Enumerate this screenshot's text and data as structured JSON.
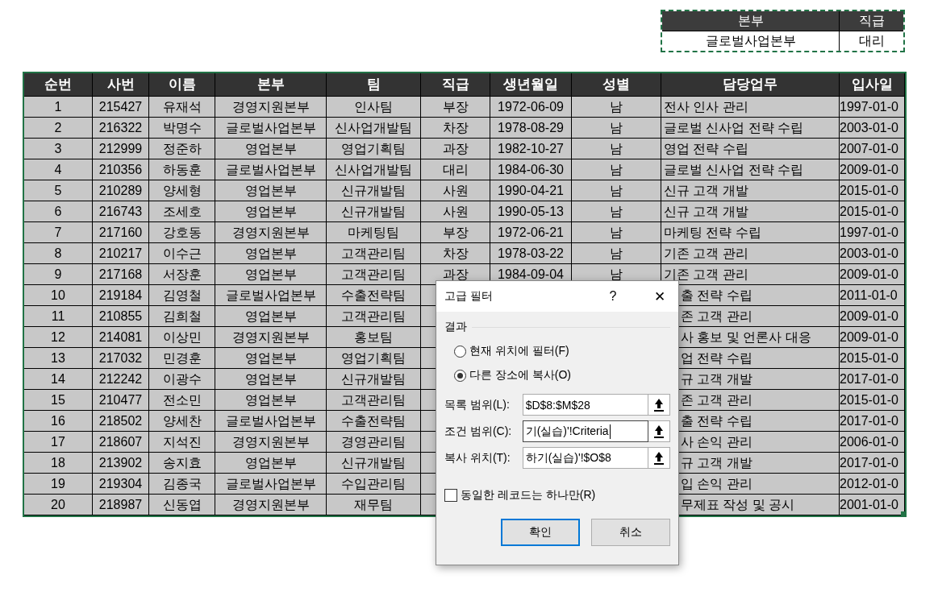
{
  "criteria": {
    "columns": [
      "본부",
      "직급"
    ],
    "values": [
      "글로벌사업본부",
      "대리"
    ]
  },
  "table": {
    "columns": [
      "순번",
      "사번",
      "이름",
      "본부",
      "팀",
      "직급",
      "생년월일",
      "성별",
      "담당업무",
      "입사일"
    ],
    "rows": [
      {
        "no": "1",
        "id": "215427",
        "name": "유재석",
        "division": "경영지원본부",
        "team": "인사팀",
        "rank": "부장",
        "birth": "1972-06-09",
        "gender": "남",
        "duty": "전사 인사 관리",
        "hire": "1997-01-0"
      },
      {
        "no": "2",
        "id": "216322",
        "name": "박명수",
        "division": "글로벌사업본부",
        "team": "신사업개발팀",
        "rank": "차장",
        "birth": "1978-08-29",
        "gender": "남",
        "duty": "글로벌 신사업 전략 수립",
        "hire": "2003-01-0"
      },
      {
        "no": "3",
        "id": "212999",
        "name": "정준하",
        "division": "영업본부",
        "team": "영업기획팀",
        "rank": "과장",
        "birth": "1982-10-27",
        "gender": "남",
        "duty": "영업 전략 수립",
        "hire": "2007-01-0"
      },
      {
        "no": "4",
        "id": "210356",
        "name": "하동훈",
        "division": "글로벌사업본부",
        "team": "신사업개발팀",
        "rank": "대리",
        "birth": "1984-06-30",
        "gender": "남",
        "duty": "글로벌 신사업 전략 수립",
        "hire": "2009-01-0"
      },
      {
        "no": "5",
        "id": "210289",
        "name": "양세형",
        "division": "영업본부",
        "team": "신규개발팀",
        "rank": "사원",
        "birth": "1990-04-21",
        "gender": "남",
        "duty": "신규 고객 개발",
        "hire": "2015-01-0"
      },
      {
        "no": "6",
        "id": "216743",
        "name": "조세호",
        "division": "영업본부",
        "team": "신규개발팀",
        "rank": "사원",
        "birth": "1990-05-13",
        "gender": "남",
        "duty": "신규 고객 개발",
        "hire": "2015-01-0"
      },
      {
        "no": "7",
        "id": "217160",
        "name": "강호동",
        "division": "경영지원본부",
        "team": "마케팅팀",
        "rank": "부장",
        "birth": "1972-06-21",
        "gender": "남",
        "duty": "마케팅 전략 수립",
        "hire": "1997-01-0"
      },
      {
        "no": "8",
        "id": "210217",
        "name": "이수근",
        "division": "영업본부",
        "team": "고객관리팀",
        "rank": "차장",
        "birth": "1978-03-22",
        "gender": "남",
        "duty": "기존 고객 관리",
        "hire": "2003-01-0"
      },
      {
        "no": "9",
        "id": "217168",
        "name": "서장훈",
        "division": "영업본부",
        "team": "고객관리팀",
        "rank": "과장",
        "birth": "1984-09-04",
        "gender": "남",
        "duty": "기존 고객 관리",
        "hire": "2009-01-0"
      },
      {
        "no": "10",
        "id": "219184",
        "name": "김영철",
        "division": "글로벌사업본부",
        "team": "수출전략팀",
        "duty": "출 전략 수립",
        "hire": "2011-01-0"
      },
      {
        "no": "11",
        "id": "210855",
        "name": "김희철",
        "division": "영업본부",
        "team": "고객관리팀",
        "duty": "존 고객 관리",
        "hire": "2009-01-0"
      },
      {
        "no": "12",
        "id": "214081",
        "name": "이상민",
        "division": "경영지원본부",
        "team": "홍보팀",
        "duty": "사 홍보 및 언론사 대응",
        "hire": "2009-01-0"
      },
      {
        "no": "13",
        "id": "217032",
        "name": "민경훈",
        "division": "영업본부",
        "team": "영업기획팀",
        "duty": "업 전략 수립",
        "hire": "2015-01-0"
      },
      {
        "no": "14",
        "id": "212242",
        "name": "이광수",
        "division": "영업본부",
        "team": "신규개발팀",
        "duty": "규 고객 개발",
        "hire": "2017-01-0"
      },
      {
        "no": "15",
        "id": "210477",
        "name": "전소민",
        "division": "영업본부",
        "team": "고객관리팀",
        "duty": "존 고객 관리",
        "hire": "2015-01-0"
      },
      {
        "no": "16",
        "id": "218502",
        "name": "양세찬",
        "division": "글로벌사업본부",
        "team": "수출전략팀",
        "duty": "출 전략 수립",
        "hire": "2017-01-0"
      },
      {
        "no": "17",
        "id": "218607",
        "name": "지석진",
        "division": "경영지원본부",
        "team": "경영관리팀",
        "duty": "사 손익 관리",
        "hire": "2006-01-0"
      },
      {
        "no": "18",
        "id": "213902",
        "name": "송지효",
        "division": "영업본부",
        "team": "신규개발팀",
        "duty": "규 고객 개발",
        "hire": "2017-01-0"
      },
      {
        "no": "19",
        "id": "219304",
        "name": "김종국",
        "division": "글로벌사업본부",
        "team": "수입관리팀",
        "duty": "입 손익 관리",
        "hire": "2012-01-0"
      },
      {
        "no": "20",
        "id": "218987",
        "name": "신동엽",
        "division": "경영지원본부",
        "team": "재무팀",
        "duty": "무제표 작성 및 공시",
        "hire": "2001-01-0"
      }
    ]
  },
  "dialog": {
    "title": "고급 필터",
    "help": "?",
    "close": "✕",
    "group": "결과",
    "options": [
      {
        "label": "현재 위치에 필터(F)",
        "selected": false
      },
      {
        "label": "다른 장소에 복사(O)",
        "selected": true
      }
    ],
    "fields": [
      {
        "label": "목록 범위(L):",
        "value": "$D$8:$M$28",
        "focused": false
      },
      {
        "label": "조건 범위(C):",
        "value": "기(실습)'!Criteria",
        "focused": true
      },
      {
        "label": "복사 위치(T):",
        "value": "하기(실습)'!$O$8",
        "focused": false
      }
    ],
    "unique": {
      "label": "동일한 레코드는 하나만(R)",
      "checked": false
    },
    "buttons": [
      {
        "label": "확인",
        "default": true
      },
      {
        "label": "취소",
        "default": false
      }
    ]
  }
}
